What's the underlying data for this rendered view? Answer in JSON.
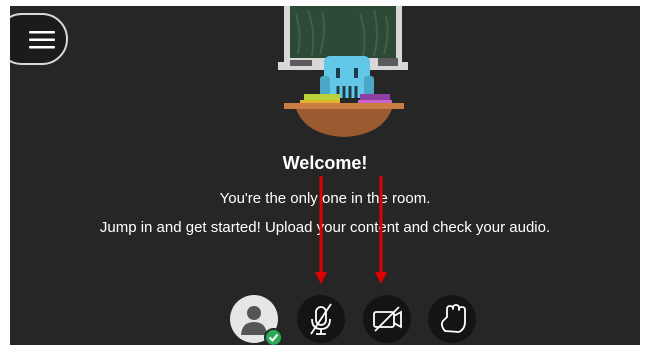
{
  "welcome": {
    "title": "Welcome!",
    "line1": "You're the only one in the room.",
    "line2": "Jump in and get started! Upload your content and check your audio."
  },
  "icons": {
    "menu": "hamburger-menu-icon",
    "avatar": "user-avatar-icon",
    "status": "checkmark-icon",
    "microphone": "microphone-off-icon",
    "camera": "camera-off-icon",
    "hand": "raise-hand-icon"
  },
  "colors": {
    "background": "#262626",
    "control": "#141414",
    "status": "#2aa957",
    "annotation_arrow": "#e00000"
  }
}
